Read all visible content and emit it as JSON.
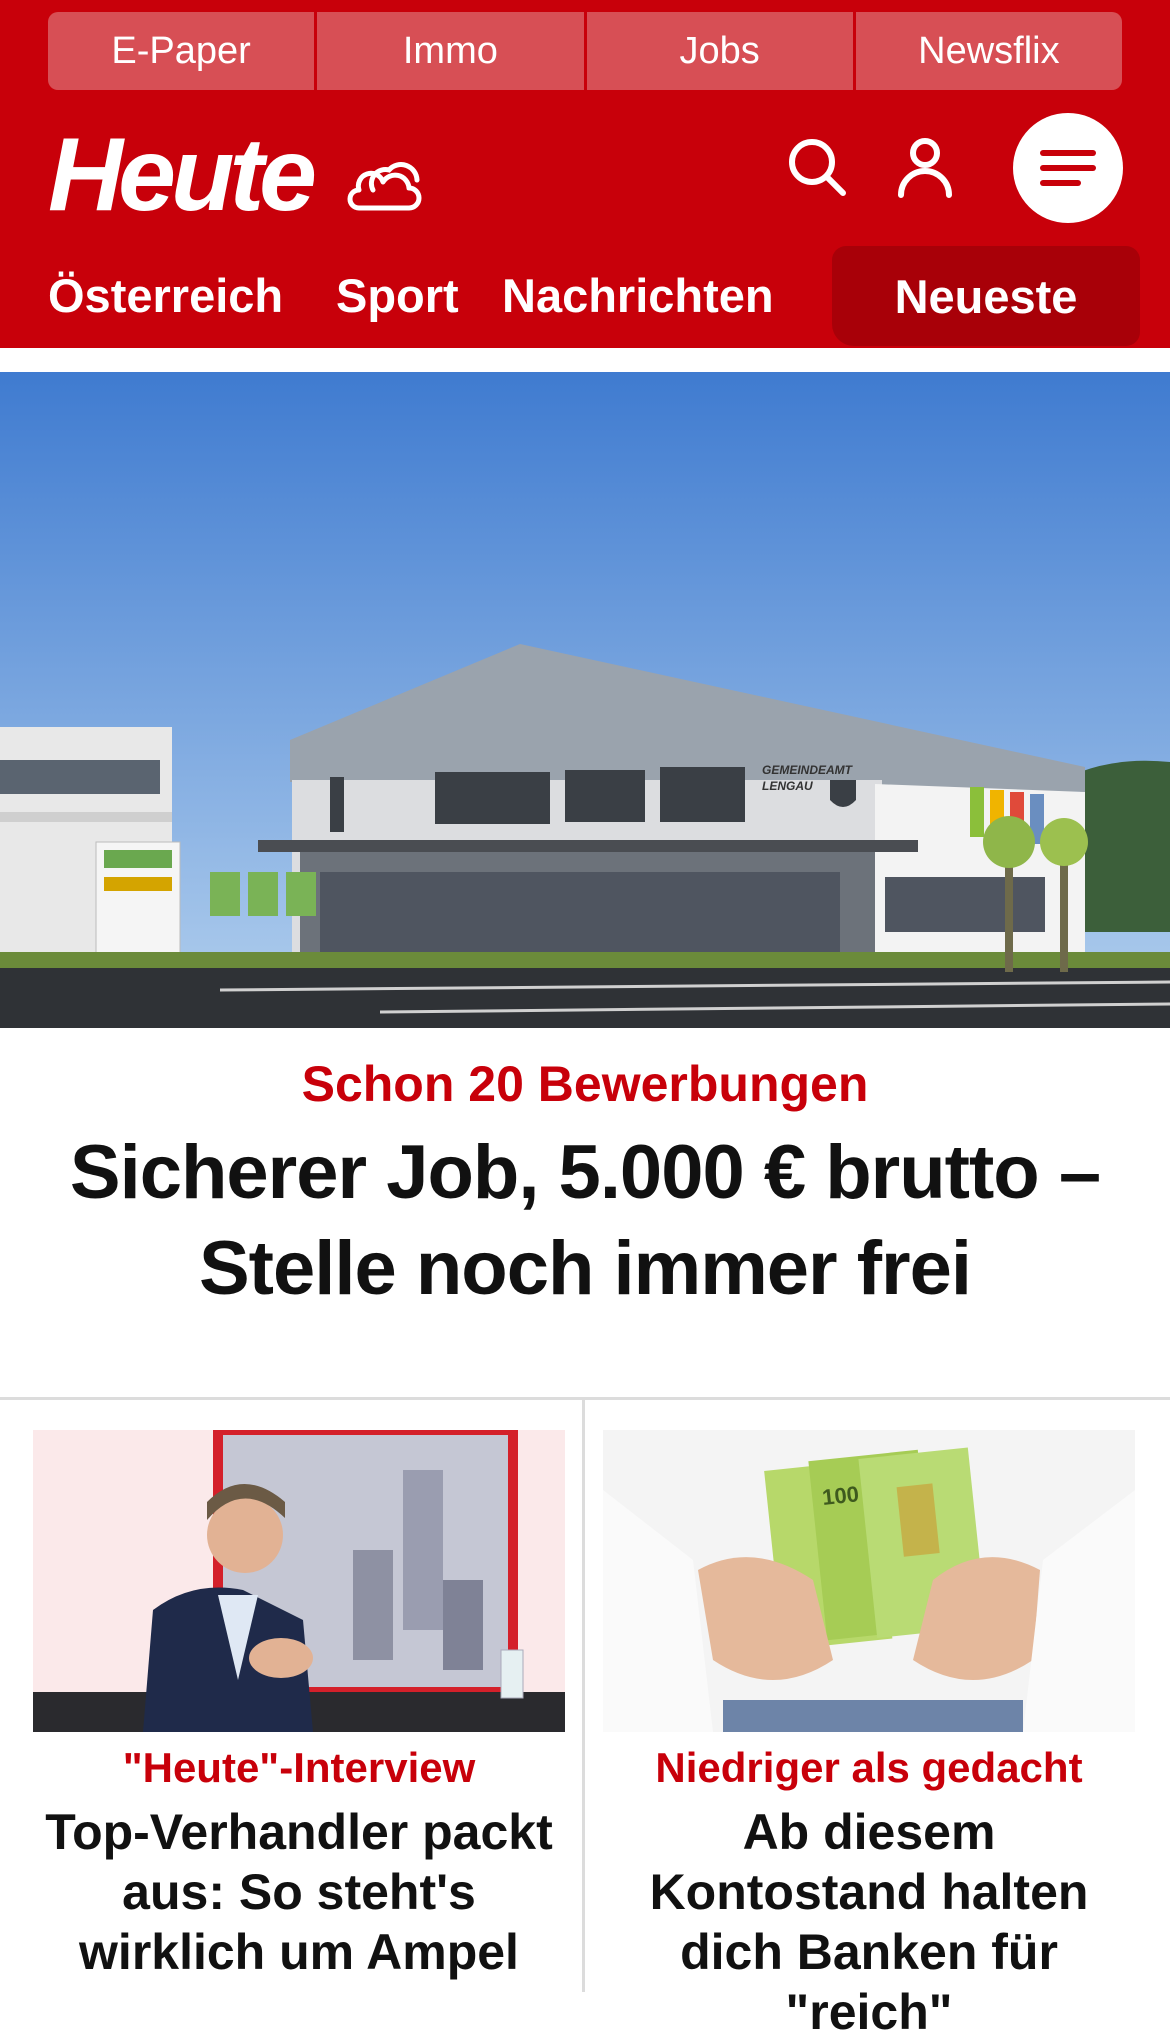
{
  "topnav": [
    "E-Paper",
    "Immo",
    "Jobs",
    "Newsflix"
  ],
  "brand": {
    "logo_text": "Heute"
  },
  "header_icons": [
    "weather-icon",
    "search-icon",
    "user-icon",
    "menu-icon"
  ],
  "categories": [
    "Österreich",
    "Sport",
    "Nachrichten"
  ],
  "categories_highlight": "Neueste",
  "hero": {
    "kicker": "Schon 20 Bewerbungen",
    "title": "Sicherer Job, 5.000 € brutto – Stelle noch immer frei",
    "sign_text_1": "GEMEINDEAMT",
    "sign_text_2": "LENGAU"
  },
  "cards": [
    {
      "kicker": "\"Heute\"-Interview",
      "title": "Top-Verhandler packt aus: So steht's wirklich um Ampel"
    },
    {
      "kicker": "Niedriger als gedacht",
      "title": "Ab diesem Kontostand halten dich Banken für \"reich\"",
      "banknote_label": "100"
    }
  ],
  "colors": {
    "brand_red": "#c8000a",
    "topnav_tab": "#d74f55",
    "active_tab": "#a80008"
  }
}
